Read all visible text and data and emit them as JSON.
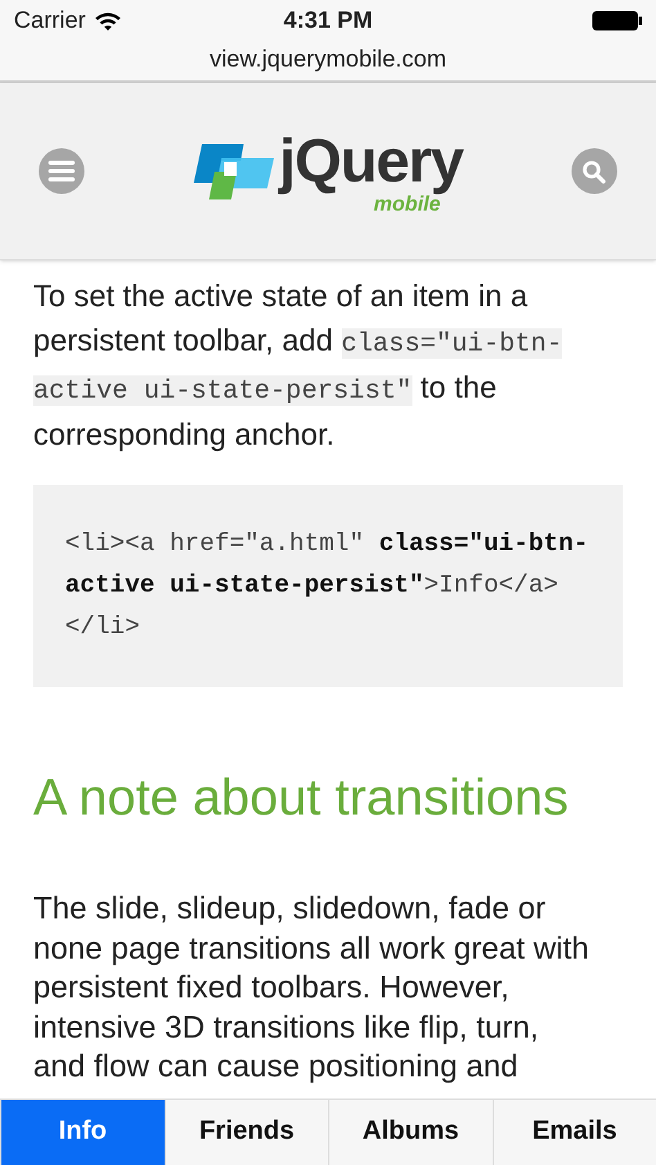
{
  "status_bar": {
    "carrier": "Carrier",
    "time": "4:31 PM"
  },
  "url_bar": {
    "url": "view.jquerymobile.com"
  },
  "header": {
    "logo": {
      "name": "jQuery",
      "tagline": "mobile"
    }
  },
  "intro": [
    {
      "kind": "text",
      "text": "To set the active state of an item in a persistent toolbar, add "
    },
    {
      "kind": "code",
      "text": "class=\"ui-btn-active ui-state-persist\""
    },
    {
      "kind": "text",
      "text": " to the corresponding anchor."
    }
  ],
  "code_block": [
    {
      "bold": false,
      "text": "<li><a href=\"a.html\" "
    },
    {
      "bold": true,
      "text": "class=\"ui-btn-active ui-state-persist\""
    },
    {
      "bold": false,
      "text": ">Info</a></li>"
    }
  ],
  "heading": "A note about transitions",
  "paragraph": "The slide, slideup, slidedown, fade or none page transitions all work great with persistent fixed toolbars. However, intensive 3D transitions like flip, turn, and flow can cause positioning and",
  "tabs": [
    {
      "label": "Info",
      "selected": true
    },
    {
      "label": "Friends",
      "selected": false
    },
    {
      "label": "Albums",
      "selected": false
    },
    {
      "label": "Emails",
      "selected": false
    }
  ]
}
